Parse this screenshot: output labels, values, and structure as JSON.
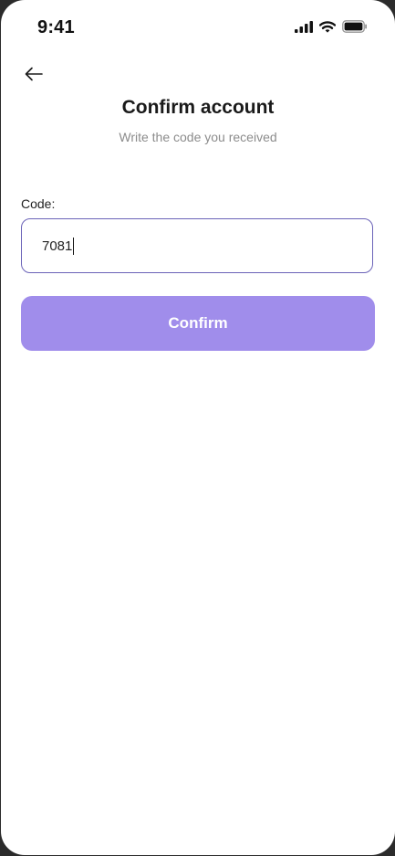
{
  "status_bar": {
    "time": "9:41",
    "icons": [
      "cellular-signal-icon",
      "wifi-icon",
      "battery-icon"
    ]
  },
  "header": {
    "back_icon": "arrow-left-icon",
    "title": "Confirm account",
    "subtitle": "Write the code you received"
  },
  "form": {
    "code_label": "Code:",
    "code_value": "7081"
  },
  "actions": {
    "confirm_label": "Confirm"
  },
  "colors": {
    "accent": "#a08deb",
    "field_border": "#6b63b8",
    "subtitle_text": "#8c8c8c"
  }
}
